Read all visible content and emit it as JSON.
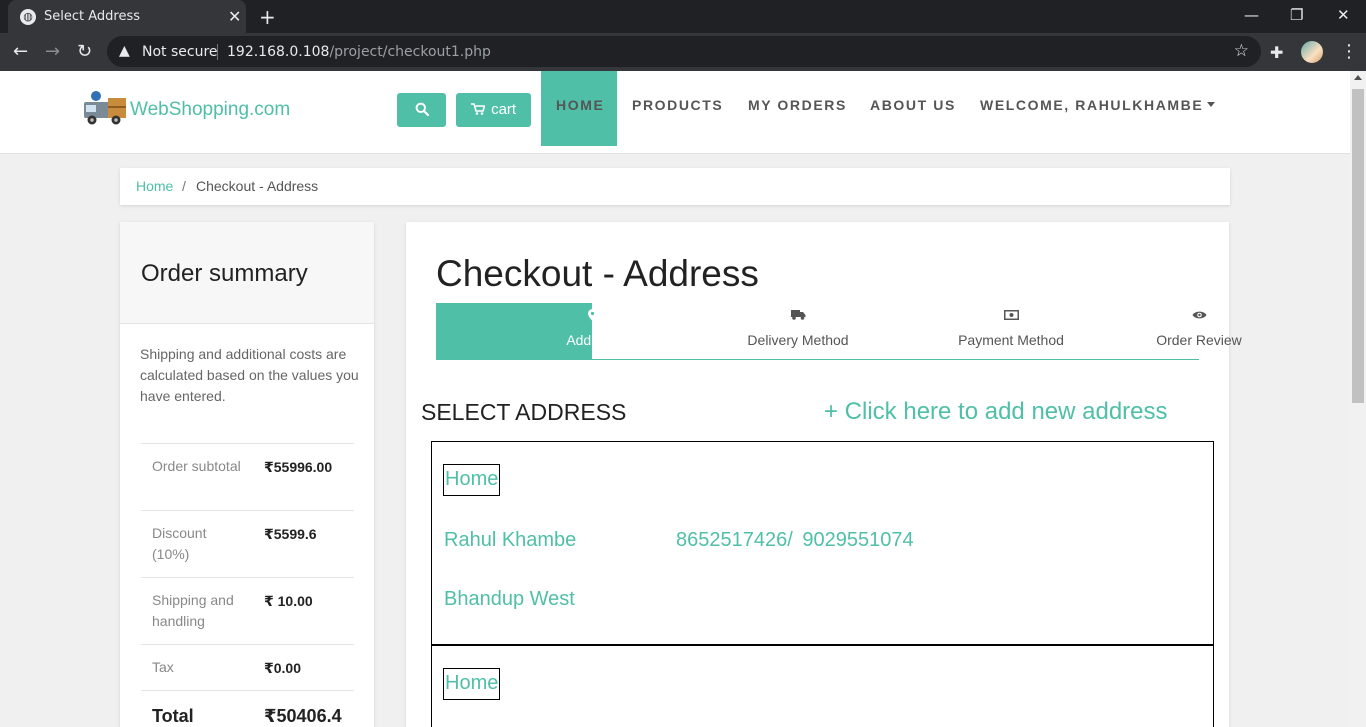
{
  "browser": {
    "tab_title": "Select Address",
    "security_label": "Not secure",
    "url_host": "192.168.0.108",
    "url_path": "/project/checkout1.php"
  },
  "site": {
    "logo_text": "WebShopping.com",
    "cart_label": "cart",
    "nav": {
      "home": "HOME",
      "products": "PRODUCTS",
      "orders": "MY ORDERS",
      "about": "ABOUT US",
      "welcome": "WELCOME, RAHULKHAMBE"
    }
  },
  "breadcrumb": {
    "home": "Home",
    "separator": "/",
    "current": "Checkout - Address"
  },
  "summary": {
    "title": "Order summary",
    "note": "Shipping and additional costs are calculated based on the values you have entered.",
    "rows": [
      {
        "label": "Order subtotal",
        "value": "₹55996.00"
      },
      {
        "label": "Discount (10%)",
        "value": "₹5599.6"
      },
      {
        "label": "Shipping and handling",
        "value": "₹ 10.00"
      },
      {
        "label": "Tax",
        "value": "₹0.00"
      },
      {
        "label": "Total",
        "value": "₹50406.4"
      }
    ]
  },
  "checkout": {
    "title": "Checkout - Address",
    "steps": [
      {
        "label": "Address",
        "icon": "map-marker-icon",
        "active": true
      },
      {
        "label": "Delivery Method",
        "icon": "truck-icon",
        "active": false
      },
      {
        "label": "Payment Method",
        "icon": "money-icon",
        "active": false
      },
      {
        "label": "Order Review",
        "icon": "eye-icon",
        "active": false
      }
    ],
    "select_heading": "SELECT ADDRESS",
    "add_address": "+ Click here to add new address",
    "addresses": [
      {
        "tag": "Home",
        "name": "Rahul Khambe",
        "phones": "8652517426/ 9029551074",
        "area": "Bhandup West"
      },
      {
        "tag": "Home"
      }
    ]
  },
  "colors": {
    "accent": "#4fbfa8",
    "chrome_dark": "#202124",
    "chrome_toolbar": "#35363a"
  }
}
